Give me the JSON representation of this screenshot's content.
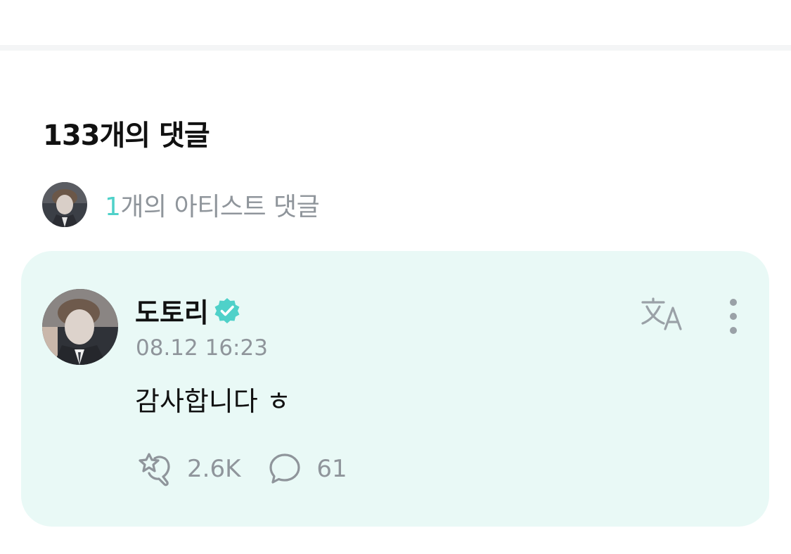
{
  "header": {
    "comment_count_title": "133개의 댓글"
  },
  "artist_summary": {
    "count": "1",
    "label": "개의 아티스트 댓글"
  },
  "comment": {
    "author": "도토리",
    "verified": true,
    "timestamp": "08.12 16:23",
    "body": "감사합니다 ㅎ",
    "likes": "2.6K",
    "replies": "61"
  },
  "icons": {
    "verified": "verified-badge-icon",
    "translate": "translate-icon",
    "more": "more-vertical-icon",
    "like": "cheer-like-icon",
    "reply": "reply-bubble-icon"
  },
  "colors": {
    "accent": "#4fd1c9",
    "card_background": "#e9f9f6",
    "muted_text": "#8f959b",
    "primary_text": "#111111",
    "divider": "#f4f5f6"
  }
}
